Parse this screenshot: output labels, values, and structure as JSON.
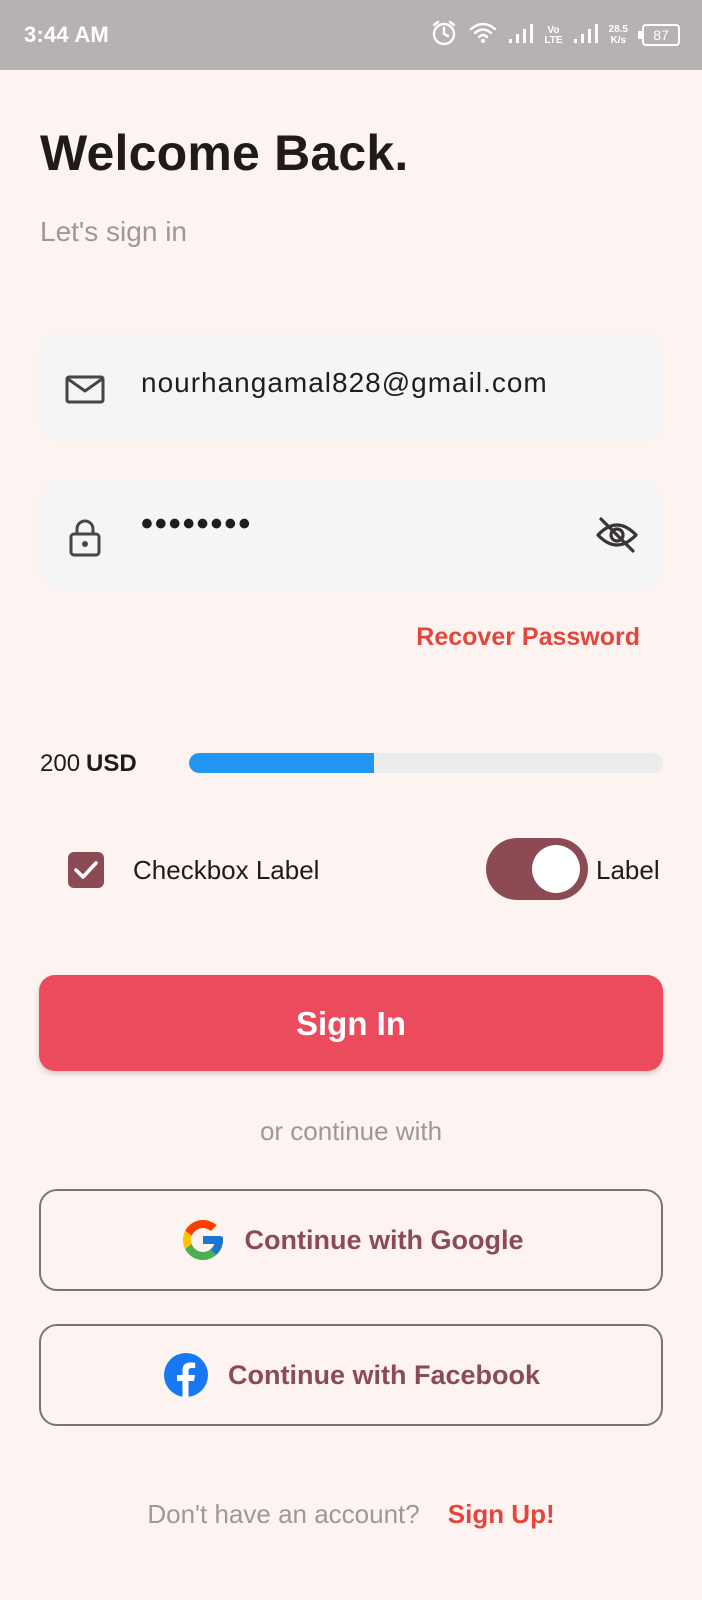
{
  "status_bar": {
    "time": "3:44 AM",
    "volte_top": "Vo",
    "volte_bottom": "LTE",
    "speed_value": "28.5",
    "speed_unit": "K/s",
    "battery": "87"
  },
  "header": {
    "title": "Welcome Back.",
    "subtitle": "Let's sign in"
  },
  "form": {
    "email_value": "nourhangamal828@gmail.com",
    "password_value": "••••••••",
    "recover_label": "Recover Password"
  },
  "amount": {
    "value": "200",
    "currency": "USD",
    "progress_fraction": 0.39
  },
  "options": {
    "checkbox_label": "Checkbox Label",
    "checkbox_checked": true,
    "switch_label": "Label",
    "switch_on": true
  },
  "actions": {
    "signin_label": "Sign In",
    "or_text": "or continue with",
    "google_label": "Continue with Google",
    "facebook_label": "Continue with Facebook"
  },
  "footer": {
    "text": "Don't have an account?",
    "signup_label": "Sign Up!"
  },
  "colors": {
    "background": "#fdf4f2",
    "accent": "#ec4a5d",
    "link": "#e2463c",
    "primary_dark": "#8c4b52",
    "progress": "#2196f3"
  },
  "icons": {
    "email": "mail-icon",
    "password": "lock-icon",
    "visibility": "eye-off-icon",
    "google": "google-icon",
    "facebook": "facebook-icon",
    "alarm": "alarm-icon",
    "wifi": "wifi-icon",
    "signal": "signal-icon",
    "battery": "battery-icon"
  }
}
